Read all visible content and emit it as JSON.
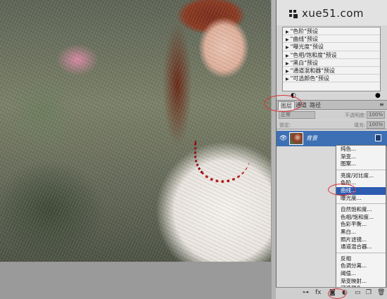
{
  "logo": {
    "text": "xue51.com"
  },
  "presets": {
    "items": [
      "\"色阶\"预设",
      "\"曲线\"预设",
      "\"曝光度\"预设",
      "\"色相/饱和度\"预设",
      "\"黑白\"预设",
      "\"通道混和器\"预设",
      "\"可选颜色\"预设"
    ]
  },
  "tabs": [
    {
      "label": "图层",
      "active": true
    },
    {
      "label": "通道",
      "active": false
    },
    {
      "label": "路径",
      "active": false
    }
  ],
  "blend": {
    "mode": "正常",
    "opacity_label": "不透明度:",
    "opacity_value": "100%"
  },
  "fill": {
    "lock_label": "锁定:",
    "fill_label": "填充:",
    "fill_value": "100%"
  },
  "layer": {
    "name": "背景"
  },
  "menu": {
    "groups": [
      [
        "纯色...",
        "渐变...",
        "图案..."
      ],
      [
        "亮度/对比度...",
        "色阶...",
        "曲线...",
        "曝光度..."
      ],
      [
        "自然饱和度...",
        "色相/饱和度...",
        "色彩平衡...",
        "黑白...",
        "照片滤镜...",
        "通道混合器..."
      ],
      [
        "反相",
        "色调分离...",
        "阈值...",
        "渐变映射...",
        "可选颜色..."
      ]
    ],
    "highlighted": "曲线..."
  },
  "colors": {
    "highlight": "#2c5bb0",
    "annotation": "#d9333a",
    "layer_selected": "#3d6fb4"
  }
}
